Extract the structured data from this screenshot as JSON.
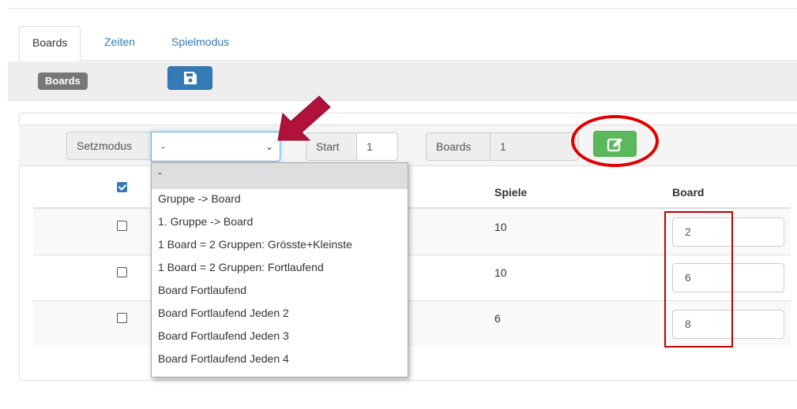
{
  "tabs": [
    {
      "label": "Boards",
      "active": true
    },
    {
      "label": "Zeiten",
      "active": false
    },
    {
      "label": "Spielmodus",
      "active": false
    }
  ],
  "toolbar": {
    "badge": "Boards",
    "save_icon": "floppy-disk-icon"
  },
  "filter": {
    "setzmodus_label": "Setzmodus",
    "setzmodus_value": "-",
    "start_label": "Start",
    "start_value": "1",
    "boards_label": "Boards",
    "boards_value": "1",
    "edit_icon": "edit-icon"
  },
  "table": {
    "headers": {
      "spiele": "Spiele",
      "board": "Board"
    },
    "select_all_checked": true,
    "rows": [
      {
        "spiele": "10",
        "board": "2",
        "checked": false
      },
      {
        "spiele": "10",
        "board": "6",
        "checked": false
      },
      {
        "spiele": "6",
        "board": "8",
        "checked": false
      }
    ]
  },
  "dropdown": {
    "options": [
      "-",
      "Gruppe -> Board",
      "1. Gruppe -> Board",
      "1 Board = 2 Gruppen: Grösste+Kleinste",
      "1 Board = 2 Gruppen: Fortlaufend",
      "Board Fortlaufend",
      "Board Fortlaufend Jeden 2",
      "Board Fortlaufend Jeden 3",
      "Board Fortlaufend Jeden 4"
    ],
    "selected_index": 0
  },
  "colors": {
    "primary": "#337ab7",
    "success": "#5cb85c",
    "annotation_red": "#e00000",
    "arrow": "#b0123a"
  }
}
